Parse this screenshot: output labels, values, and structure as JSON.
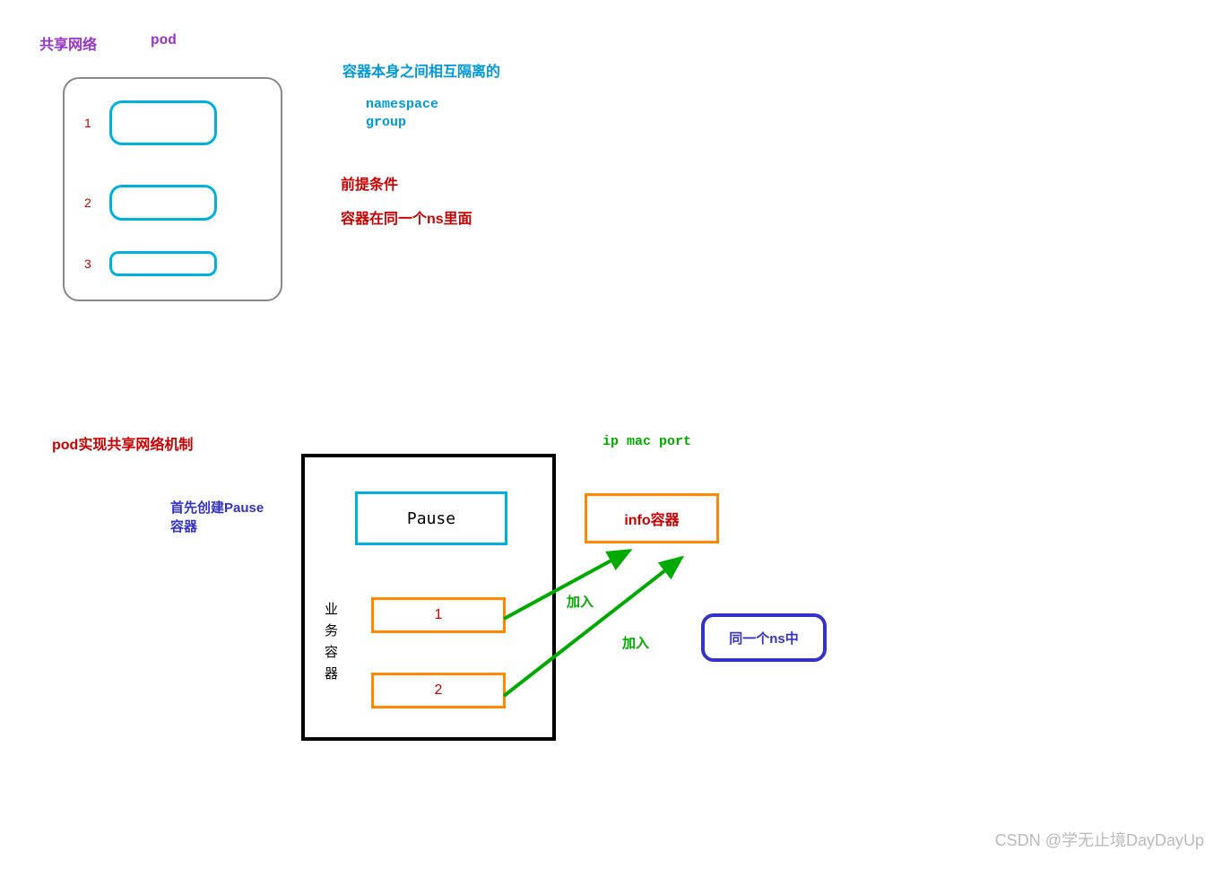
{
  "top": {
    "title_left": "共享网络",
    "title_right": "pod",
    "pod_items": [
      "1",
      "2",
      "3"
    ],
    "isolation_text": "容器本身之间相互隔离的",
    "namespace_label": "namespace",
    "group_label": "group",
    "precondition_label": "前提条件",
    "same_ns_text": "容器在同一个ns里面"
  },
  "bottom": {
    "mechanism_label": "pod实现共享网络机制",
    "pause_note_l1": "首先创建Pause",
    "pause_note_l2": "容器",
    "pause_box_label": "Pause",
    "biz_label_chars": [
      "业",
      "务",
      "容",
      "器"
    ],
    "biz1": "1",
    "biz2": "2",
    "join_label_1": "加入",
    "join_label_2": "加入",
    "info_label": "info容器",
    "info_attrs": "ip  mac port",
    "same_ns_label": "同一个ns中"
  },
  "watermark": "CSDN @学无止境DayDayUp",
  "colors": {
    "purple": "#9933cc",
    "cyan": "#00b0e0",
    "red": "#cc0000",
    "orange": "#ff8800",
    "green": "#00aa00",
    "navy": "#3333cc",
    "grey": "#888888"
  }
}
